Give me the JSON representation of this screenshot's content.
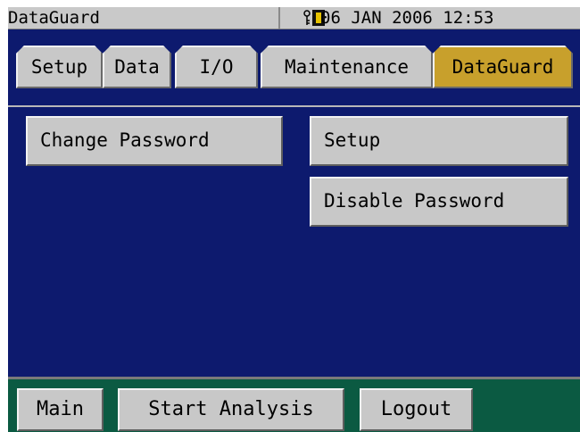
{
  "titlebar": {
    "app_title": "DataGuard",
    "datetime": "06 JAN 2006 12:53",
    "key_icon": "key-icon",
    "lock_icon": "lock-icon"
  },
  "tabs": [
    {
      "label": "Setup",
      "active": false
    },
    {
      "label": "Data",
      "active": false
    },
    {
      "label": "I/O",
      "active": false
    },
    {
      "label": "Maintenance",
      "active": false
    },
    {
      "label": "DataGuard",
      "active": true
    }
  ],
  "content": {
    "change_password": "Change Password",
    "setup": "Setup",
    "disable_password": "Disable Password"
  },
  "bottom": {
    "main": "Main",
    "start_analysis": "Start Analysis",
    "logout": "Logout"
  },
  "colors": {
    "background": "#0d1a6e",
    "active_tab": "#c8a02c",
    "bottom_bar": "#0b5a42"
  }
}
